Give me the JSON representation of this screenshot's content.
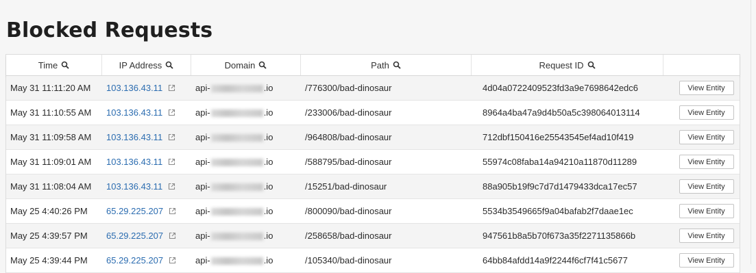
{
  "page": {
    "title": "Blocked Requests"
  },
  "table": {
    "columns": [
      {
        "label": "Time",
        "searchable": true
      },
      {
        "label": "IP Address",
        "searchable": true
      },
      {
        "label": "Domain",
        "searchable": true
      },
      {
        "label": "Path",
        "searchable": true
      },
      {
        "label": "Request ID",
        "searchable": true
      },
      {
        "label": "",
        "searchable": false
      }
    ],
    "action_label": "View Entity",
    "domain_prefix": "api-",
    "domain_suffix": ".io",
    "rows": [
      {
        "time": "May 31 11:11:20 AM",
        "ip": "103.136.43.11",
        "path": "/776300/bad-dinosaur",
        "request_id": "4d04a0722409523fd3a9e7698642edc6"
      },
      {
        "time": "May 31 11:10:55 AM",
        "ip": "103.136.43.11",
        "path": "/233006/bad-dinosaur",
        "request_id": "8964a4ba47a9d4b50a5c398064013114"
      },
      {
        "time": "May 31 11:09:58 AM",
        "ip": "103.136.43.11",
        "path": "/964808/bad-dinosaur",
        "request_id": "712dbf150416e25543545ef4ad10f419"
      },
      {
        "time": "May 31 11:09:01 AM",
        "ip": "103.136.43.11",
        "path": "/588795/bad-dinosaur",
        "request_id": "55974c08faba14a94210a11870d11289"
      },
      {
        "time": "May 31 11:08:04 AM",
        "ip": "103.136.43.11",
        "path": "/15251/bad-dinosaur",
        "request_id": "88a905b19f9c7d7d1479433dca17ec57"
      },
      {
        "time": "May 25 4:40:26 PM",
        "ip": "65.29.225.207",
        "path": "/800090/bad-dinosaur",
        "request_id": "5534b3549665f9a04bafab2f7daae1ec"
      },
      {
        "time": "May 25 4:39:57 PM",
        "ip": "65.29.225.207",
        "path": "/258658/bad-dinosaur",
        "request_id": "947561b8a5b70f673a35f2271135866b"
      },
      {
        "time": "May 25 4:39:44 PM",
        "ip": "65.29.225.207",
        "path": "/105340/bad-dinosaur",
        "request_id": "64bb84afdd14a9f2244f6cf7f41c5677"
      }
    ]
  },
  "colors": {
    "link": "#2b6cb0",
    "row_alt": "#f4f4f4",
    "background": "#f6f6f6"
  },
  "icons": {
    "search": "search-icon",
    "external_link": "external-link-icon"
  }
}
